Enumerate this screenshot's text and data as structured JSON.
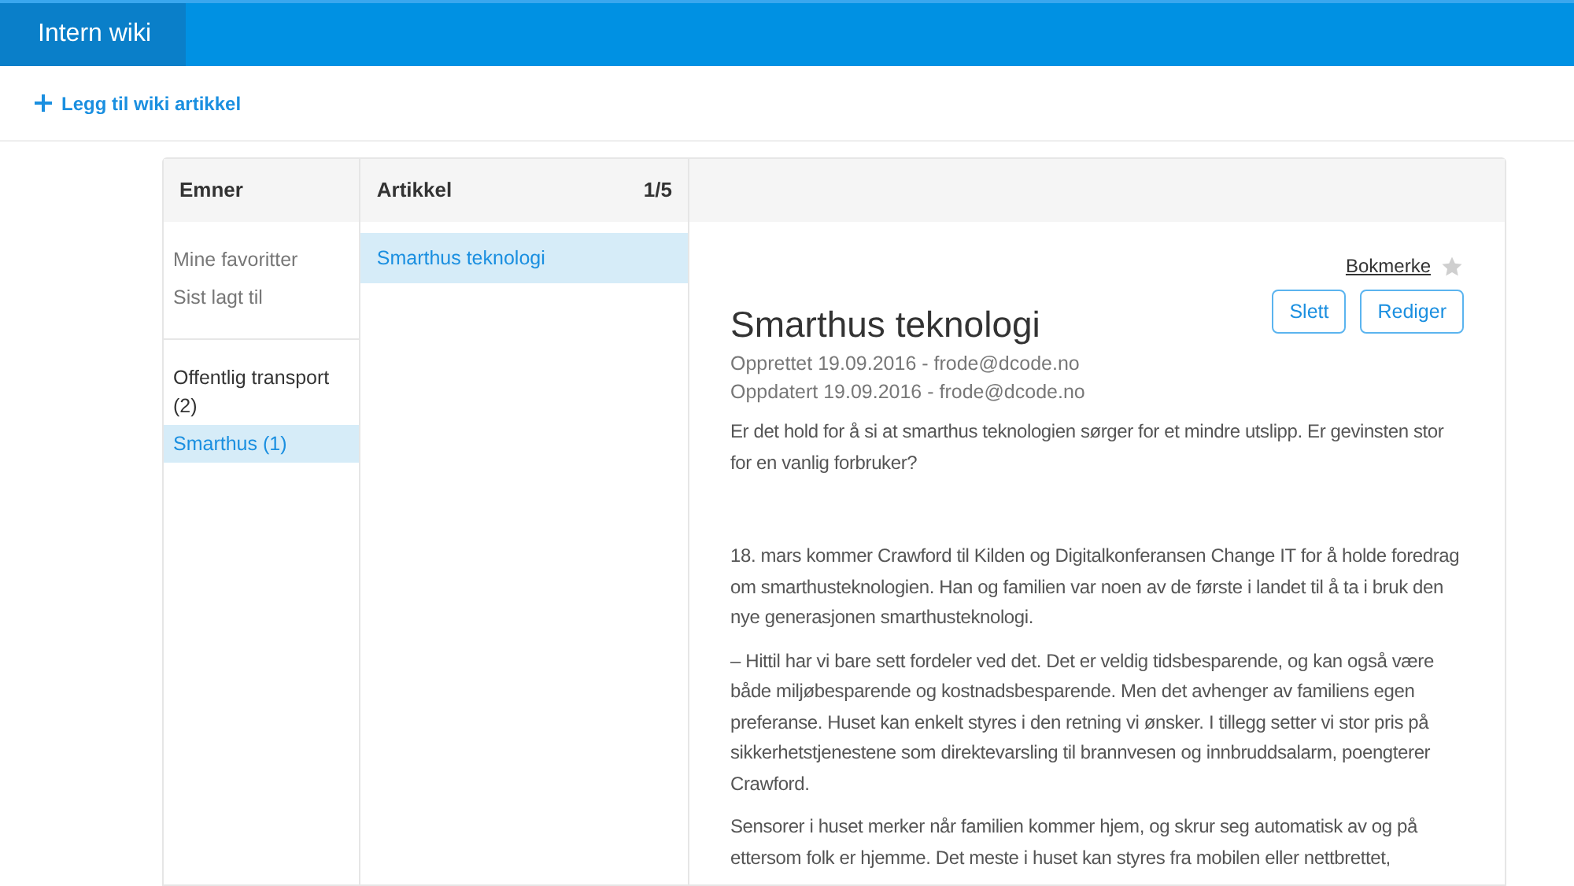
{
  "header": {
    "title": "Intern wiki"
  },
  "add_link": {
    "label": "Legg til wiki artikkel"
  },
  "topics": {
    "heading": "Emner",
    "groups": [
      {
        "kind": "filters",
        "items": [
          {
            "label": "Mine favoritter",
            "selected": false
          },
          {
            "label": "Sist lagt til",
            "selected": false
          }
        ]
      },
      {
        "kind": "categories",
        "items": [
          {
            "label": "Offentlig transport (2)",
            "selected": false
          },
          {
            "label": "Smarthus (1)",
            "selected": true
          }
        ]
      }
    ]
  },
  "articles": {
    "heading": "Artikkel",
    "count": "1/5",
    "items": [
      {
        "label": "Smarthus teknologi",
        "selected": true
      }
    ]
  },
  "article": {
    "bookmark_label": "Bokmerke",
    "bookmarked": false,
    "buttons": [
      "Slett",
      "Rediger"
    ],
    "title": "Smarthus teknologi",
    "meta": [
      "Opprettet 19.09.2016 - frode@dcode.no",
      "Oppdatert 19.09.2016 - frode@dcode.no"
    ],
    "intro": "Er det hold for å si at smarthus teknologien sørger for et mindre utslipp. Er gevinsten stor for en vanlig forbruker?",
    "paragraphs": [
      "18. mars kommer Crawford til Kilden og Digitalkonferansen Change IT for å holde foredrag om smarthusteknologien. Han og familien var noen av de første i landet til å ta i bruk den nye generasjonen smarthusteknologi.",
      "– Hittil har vi bare sett fordeler ved det. Det er veldig tidsbesparende, og kan også være både miljøbesparende og kostnadsbesparende. Men det avhenger av familiens egen preferanse. Huset kan enkelt styres i den retning vi ønsker.  I tillegg setter vi stor pris på sikkerhetstjenestene som direktevarsling til brannvesen og innbruddsalarm, poengterer Crawford.",
      "Sensorer i huset merker når familien kommer hjem, og skrur seg automatisk av og på ettersom folk er hjemme. Det meste i huset kan styres fra mobilen eller nettbrettet,"
    ]
  }
}
